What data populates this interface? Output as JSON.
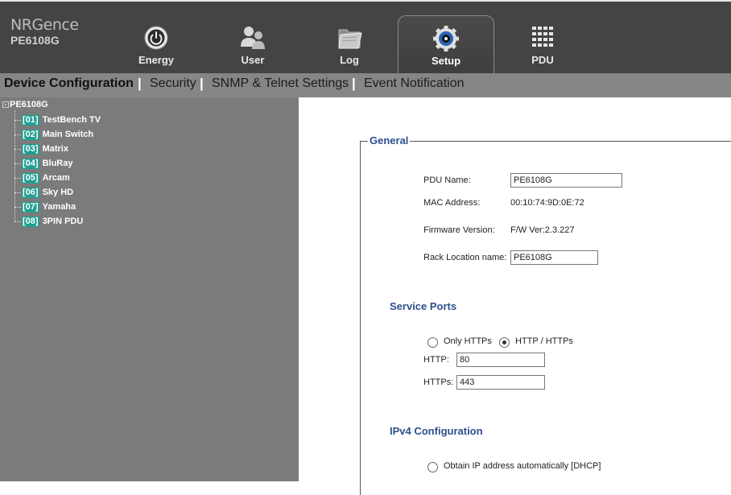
{
  "header": {
    "brand": "NRGence",
    "model": "PE6108G",
    "tabs": [
      {
        "label": "Energy",
        "icon": "power-icon"
      },
      {
        "label": "User",
        "icon": "users-icon"
      },
      {
        "label": "Log",
        "icon": "folder-icon"
      },
      {
        "label": "Setup",
        "icon": "gear-icon",
        "active": true
      },
      {
        "label": "PDU",
        "icon": "grid-icon"
      }
    ]
  },
  "subnav": {
    "items": [
      {
        "label": "Device Configuration",
        "active": true
      },
      {
        "label": "Security"
      },
      {
        "label": "SNMP & Telnet Settings"
      },
      {
        "label": "Event Notification"
      }
    ],
    "separator": "|"
  },
  "sidebar": {
    "root": "PE6108G",
    "toggle": "-",
    "items": [
      {
        "num": "[01]",
        "name": "TestBench TV"
      },
      {
        "num": "[02]",
        "name": "Main Switch"
      },
      {
        "num": "[03]",
        "name": "Matrix"
      },
      {
        "num": "[04]",
        "name": "BluRay"
      },
      {
        "num": "[05]",
        "name": "Arcam"
      },
      {
        "num": "[06]",
        "name": "Sky HD"
      },
      {
        "num": "[07]",
        "name": "Yamaha"
      },
      {
        "num": "[08]",
        "name": "3PIN PDU"
      }
    ]
  },
  "general": {
    "legend": "General",
    "pdu_name_label": "PDU Name:",
    "pdu_name_value": "PE6108G",
    "mac_label": "MAC Address:",
    "mac_value": "00:10:74:9D:0E:72",
    "firmware_label": "Firmware Version:",
    "firmware_value": "F/W Ver:2.3.227",
    "rack_label": "Rack Location name:",
    "rack_value": "PE6108G"
  },
  "service_ports": {
    "title": "Service Ports",
    "only_https": "Only HTTPs",
    "http_https": "HTTP / HTTPs",
    "selected": "http_https",
    "http_label": "HTTP:",
    "http_value": "80",
    "https_label": "HTTPs:",
    "https_value": "443"
  },
  "ipv4": {
    "title": "IPv4 Configuration",
    "dhcp_label": "Obtain IP address automatically [DHCP]"
  },
  "colors": {
    "header_bg": "#444444",
    "subnav_bg": "#868686",
    "sidebar_bg": "#7b7b7b",
    "badge": "#1f9e91",
    "section_title": "#2c4f8c"
  }
}
